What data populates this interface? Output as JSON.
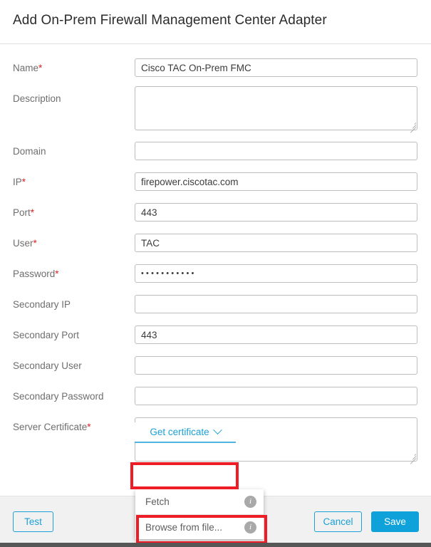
{
  "dialog": {
    "title": "Add On-Prem Firewall Management Center Adapter"
  },
  "form": {
    "required_marker": "*",
    "fields": [
      {
        "label": "Name",
        "required": true,
        "type": "text",
        "value": "Cisco TAC On-Prem FMC",
        "placeholder": ""
      },
      {
        "label": "Description",
        "required": false,
        "type": "textarea",
        "value": "",
        "placeholder": ""
      },
      {
        "label": "Domain",
        "required": false,
        "type": "text",
        "value": "",
        "placeholder": ""
      },
      {
        "label": "IP",
        "required": true,
        "type": "text",
        "value": "firepower.ciscotac.com",
        "placeholder": ""
      },
      {
        "label": "Port",
        "required": true,
        "type": "text",
        "value": "443",
        "placeholder": ""
      },
      {
        "label": "User",
        "required": true,
        "type": "text",
        "value": "TAC",
        "placeholder": ""
      },
      {
        "label": "Password",
        "required": true,
        "type": "password",
        "value": "•••••••••••",
        "placeholder": ""
      },
      {
        "label": "Secondary IP",
        "required": false,
        "type": "text",
        "value": "",
        "placeholder": ""
      },
      {
        "label": "Secondary Port",
        "required": false,
        "type": "text",
        "value": "443",
        "placeholder": ""
      },
      {
        "label": "Secondary User",
        "required": false,
        "type": "text",
        "value": "",
        "placeholder": ""
      },
      {
        "label": "Secondary Password",
        "required": false,
        "type": "text",
        "value": "",
        "placeholder": ""
      },
      {
        "label": "Server Certificate",
        "required": true,
        "type": "textarea",
        "value": "",
        "placeholder": ""
      }
    ]
  },
  "certificate": {
    "button_label": "Get certificate",
    "chevron_icon": "chevron-down-icon",
    "menu_open": true,
    "menu_items": [
      {
        "label": "Fetch",
        "info_icon": "info-icon"
      },
      {
        "label": "Browse from file...",
        "info_icon": "info-icon"
      }
    ]
  },
  "footer": {
    "test_label": "Test",
    "cancel_label": "Cancel",
    "save_label": "Save"
  },
  "colors": {
    "accent_blue": "#0fa2da",
    "link_blue": "#1ba0d7",
    "required_red": "#e02020",
    "annotation_red": "#ee1c25",
    "footer_bg": "#f1f1f1",
    "label_gray": "#6e6e6e"
  }
}
